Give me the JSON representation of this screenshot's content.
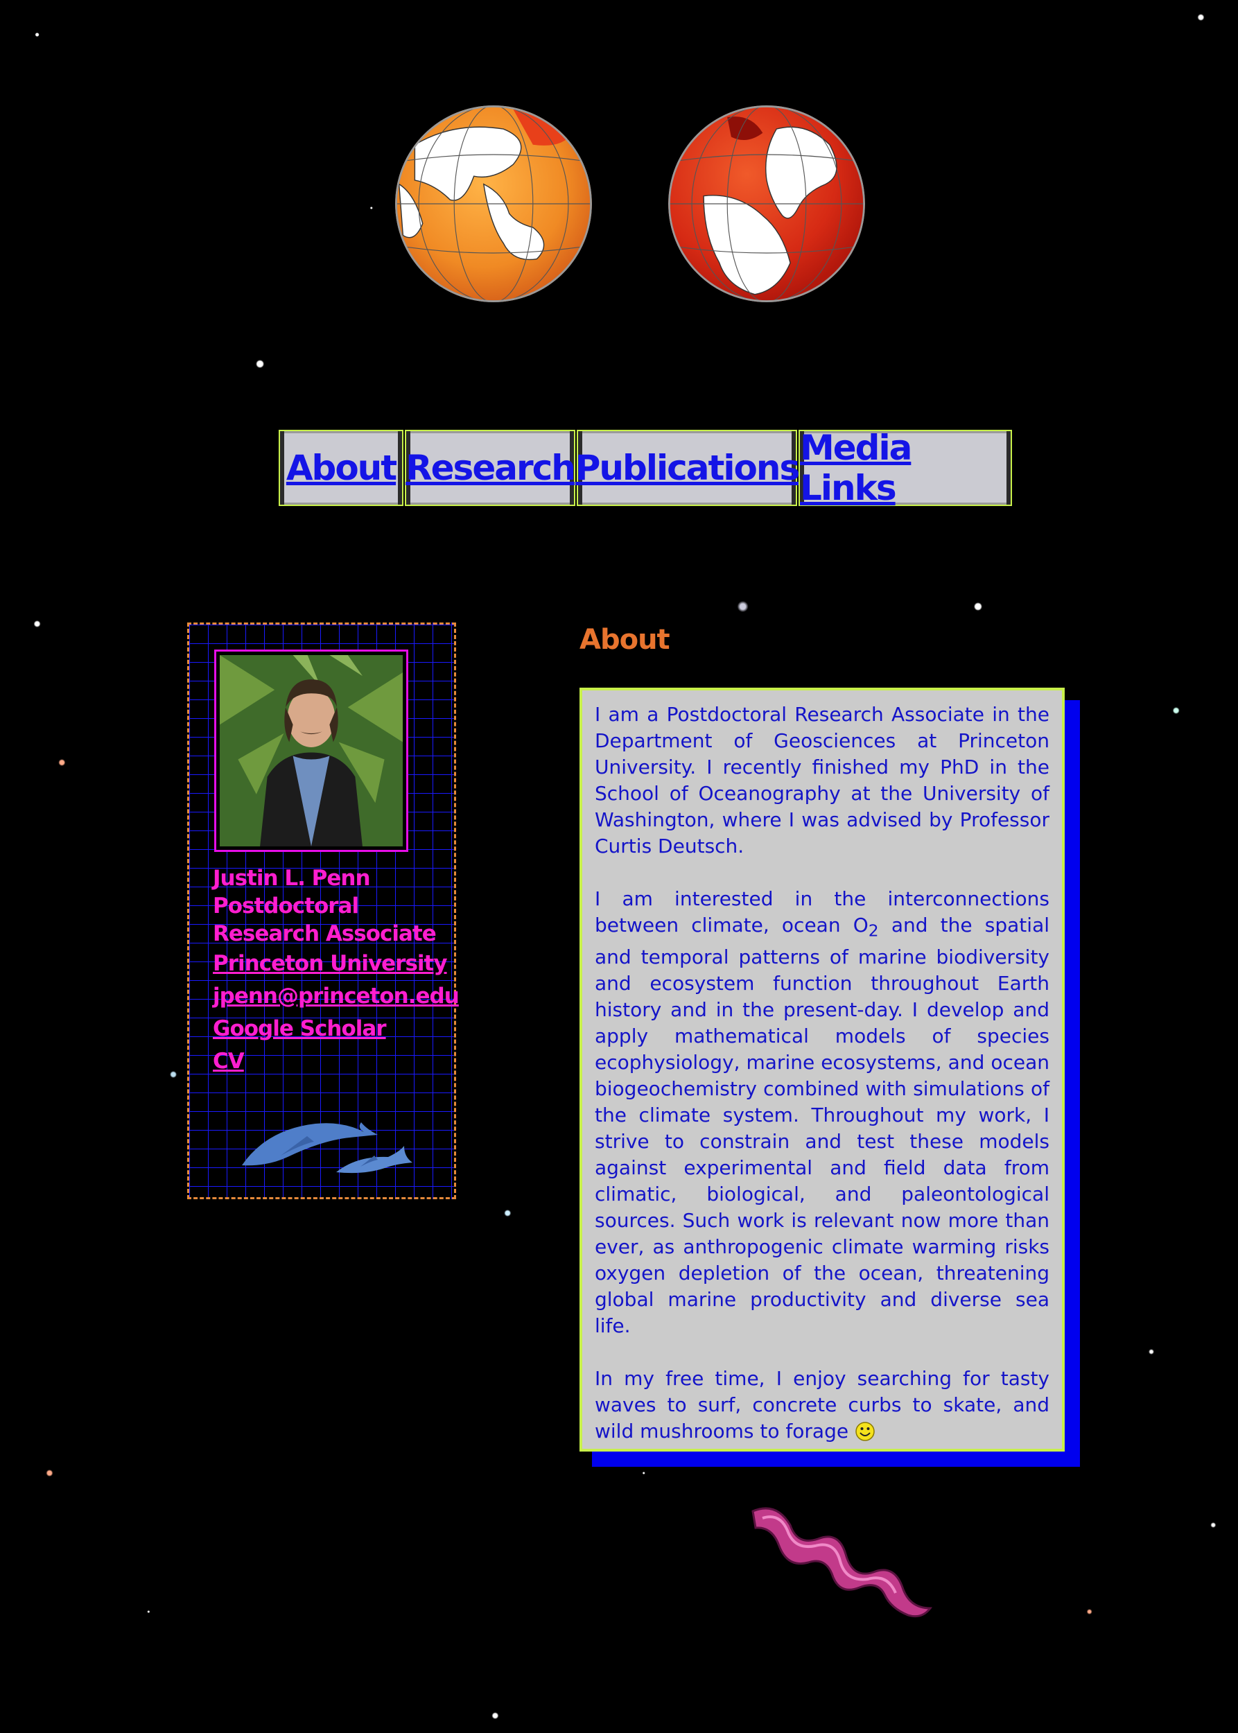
{
  "nav": {
    "items": [
      {
        "label": "About"
      },
      {
        "label": "Research"
      },
      {
        "label": "Publications"
      },
      {
        "label": "Media Links"
      }
    ]
  },
  "profile": {
    "name": "Justin L. Penn",
    "title": "Postdoctoral Research Associate",
    "affiliation": "Princeton University",
    "email": "jpenn@princeton.edu",
    "scholar": "Google Scholar",
    "cv": "CV"
  },
  "about": {
    "heading": "About",
    "p1": "I am a Postdoctoral Research Associate in the Department of Geosciences at Princeton University. I recently finished my PhD in the School of Oceanography at the University of Washington, where I was advised by Professor Curtis Deutsch.",
    "p2_before": "I am interested in the interconnections between climate, ocean O",
    "p2_sub": "2",
    "p2_after": " and the spatial and temporal patterns of marine biodiversity and ecosystem function throughout Earth history and in the present-day. I develop and apply mathematical models of species ecophysiology, marine ecosystems, and ocean biogeochemistry combined with simulations of the climate system. Throughout my work, I strive to constrain and test these models against experimental and field data from climatic, biological, and paleontological sources. Such work is relevant now more than ever, as anthropogenic climate warming risks oxygen depletion of the ocean, threatening global marine productivity and diverse sea life.",
    "p3": "In my free time, I enjoy searching for tasty waves to surf, concrete curbs to skate, and wild mushrooms to forage"
  },
  "colors": {
    "nav_link": "#1414e6",
    "nav_border": "#c8f04a",
    "profile_text": "#ff1ecf",
    "about_heading": "#e8742e",
    "about_text": "#1414c8",
    "about_bg": "#cbcbcb",
    "about_shadow": "#0000ee"
  },
  "icons": [
    "globe-map-image",
    "portrait-photo",
    "dolphins-image",
    "squid-image",
    "smiley-icon"
  ]
}
